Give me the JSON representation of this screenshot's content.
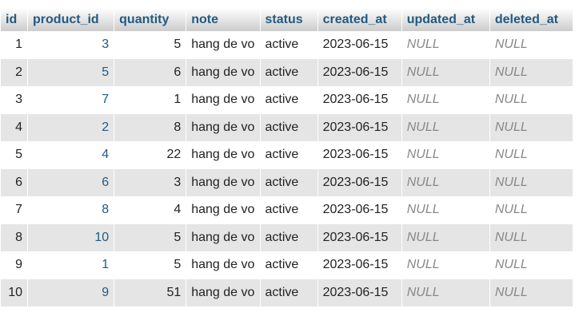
{
  "columns": [
    "id",
    "product_id",
    "quantity",
    "note",
    "status",
    "created_at",
    "updated_at",
    "deleted_at"
  ],
  "rows": [
    {
      "id": "1",
      "product_id": "3",
      "quantity": "5",
      "note": "hang de vo",
      "status": "active",
      "created_at": "2023-06-15",
      "updated_at": "NULL",
      "deleted_at": "NULL"
    },
    {
      "id": "2",
      "product_id": "5",
      "quantity": "6",
      "note": "hang de vo",
      "status": "active",
      "created_at": "2023-06-15",
      "updated_at": "NULL",
      "deleted_at": "NULL"
    },
    {
      "id": "3",
      "product_id": "7",
      "quantity": "1",
      "note": "hang de vo",
      "status": "active",
      "created_at": "2023-06-15",
      "updated_at": "NULL",
      "deleted_at": "NULL"
    },
    {
      "id": "4",
      "product_id": "2",
      "quantity": "8",
      "note": "hang de vo",
      "status": "active",
      "created_at": "2023-06-15",
      "updated_at": "NULL",
      "deleted_at": "NULL"
    },
    {
      "id": "5",
      "product_id": "4",
      "quantity": "22",
      "note": "hang de vo",
      "status": "active",
      "created_at": "2023-06-15",
      "updated_at": "NULL",
      "deleted_at": "NULL"
    },
    {
      "id": "6",
      "product_id": "6",
      "quantity": "3",
      "note": "hang de vo",
      "status": "active",
      "created_at": "2023-06-15",
      "updated_at": "NULL",
      "deleted_at": "NULL"
    },
    {
      "id": "7",
      "product_id": "8",
      "quantity": "4",
      "note": "hang de vo",
      "status": "active",
      "created_at": "2023-06-15",
      "updated_at": "NULL",
      "deleted_at": "NULL"
    },
    {
      "id": "8",
      "product_id": "10",
      "quantity": "5",
      "note": "hang de vo",
      "status": "active",
      "created_at": "2023-06-15",
      "updated_at": "NULL",
      "deleted_at": "NULL"
    },
    {
      "id": "9",
      "product_id": "1",
      "quantity": "5",
      "note": "hang de vo",
      "status": "active",
      "created_at": "2023-06-15",
      "updated_at": "NULL",
      "deleted_at": "NULL"
    },
    {
      "id": "10",
      "product_id": "9",
      "quantity": "51",
      "note": "hang de vo",
      "status": "active",
      "created_at": "2023-06-15",
      "updated_at": "NULL",
      "deleted_at": "NULL"
    }
  ],
  "colors": {
    "header_text": "#235a81",
    "row_alt": "#e5e5e5",
    "null_text": "#888888"
  }
}
